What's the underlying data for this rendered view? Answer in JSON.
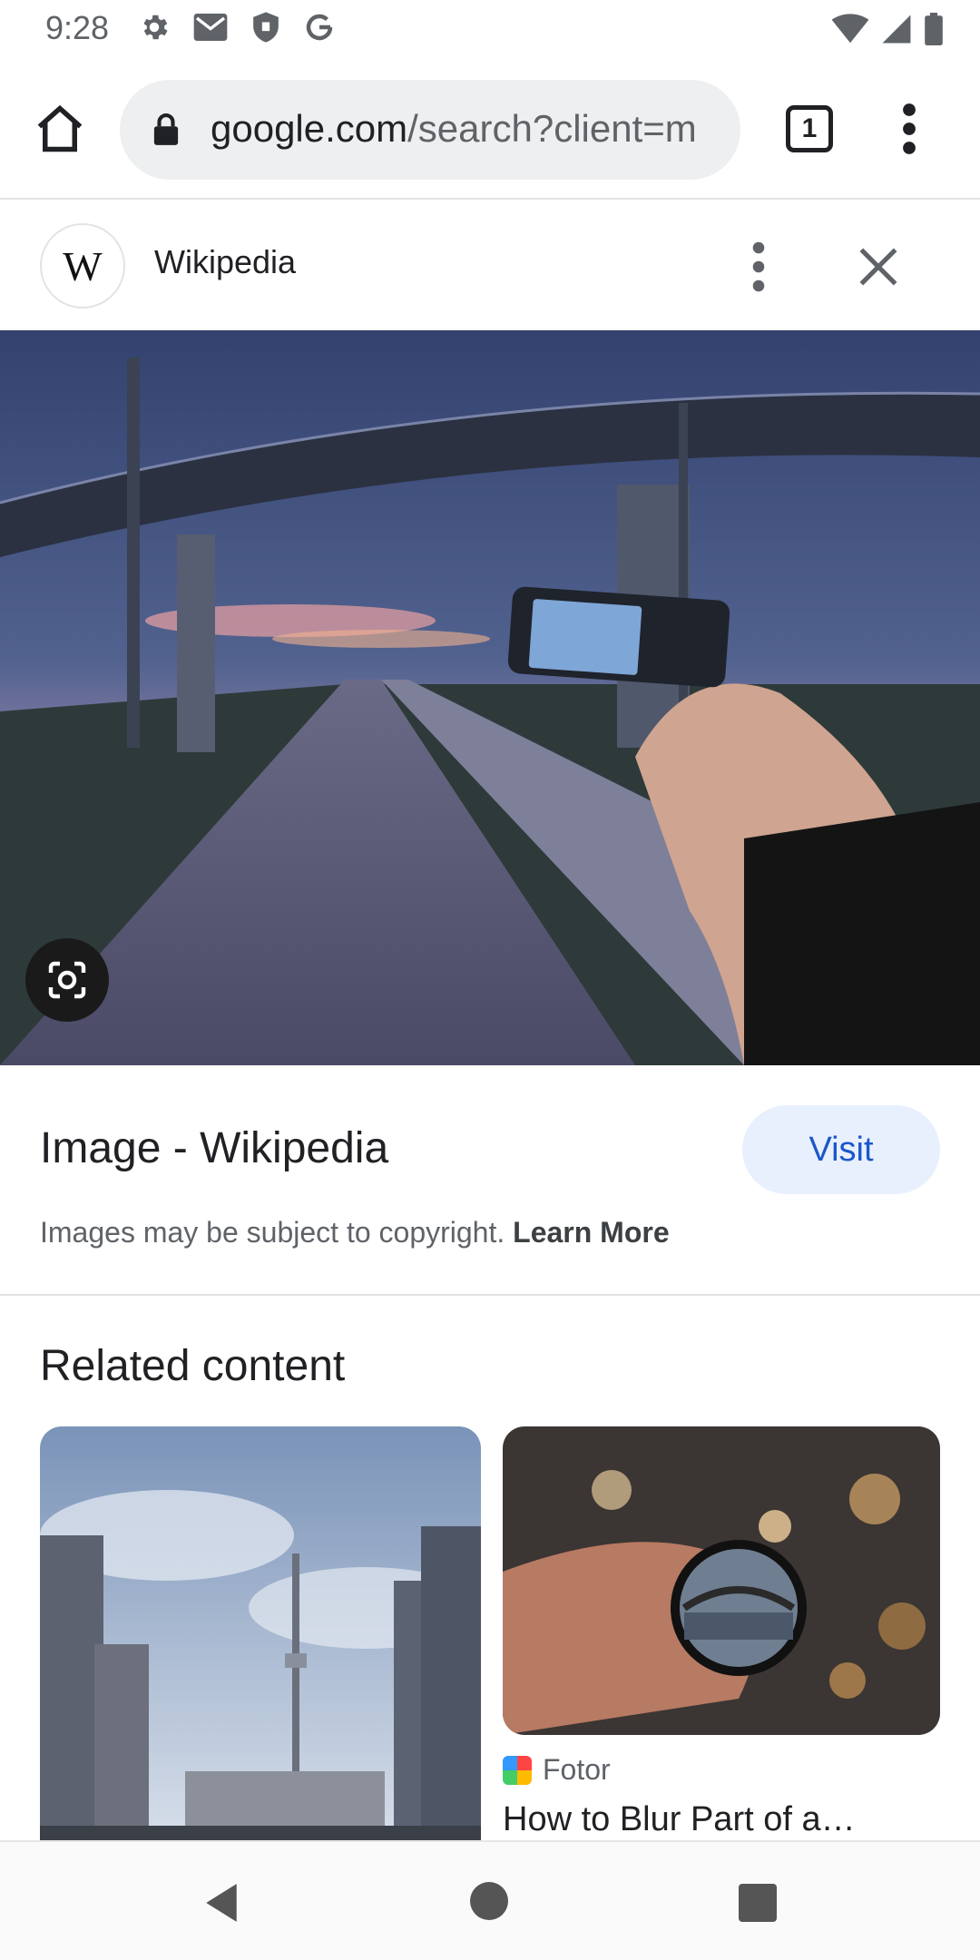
{
  "status_bar": {
    "time": "9:28",
    "left_icons": [
      "settings-icon",
      "gmail-icon",
      "shield-icon",
      "google-icon"
    ],
    "right_icons": [
      "wifi-icon",
      "signal-icon",
      "battery-icon"
    ]
  },
  "toolbar": {
    "url_domain": "google.com",
    "url_path": "/search?client=m",
    "tab_count": "1"
  },
  "source": {
    "logo_letter": "W",
    "name": "Wikipedia"
  },
  "result": {
    "title": "Image - Wikipedia",
    "visit_label": "Visit",
    "copyright_text": "Images may be subject to copyright.",
    "learn_more_label": "Learn More"
  },
  "related": {
    "heading": "Related content",
    "cards": [
      {
        "image": "cn-tower-cityscape-photo"
      },
      {
        "image": "hand-holding-lens-filter-photo",
        "source": "Fotor",
        "title": "How to Blur Part of a…"
      }
    ]
  },
  "colors": {
    "accent": "#1a57c9",
    "visit_bg": "#e8f0fe",
    "url_bar_bg": "#eeeff0"
  }
}
